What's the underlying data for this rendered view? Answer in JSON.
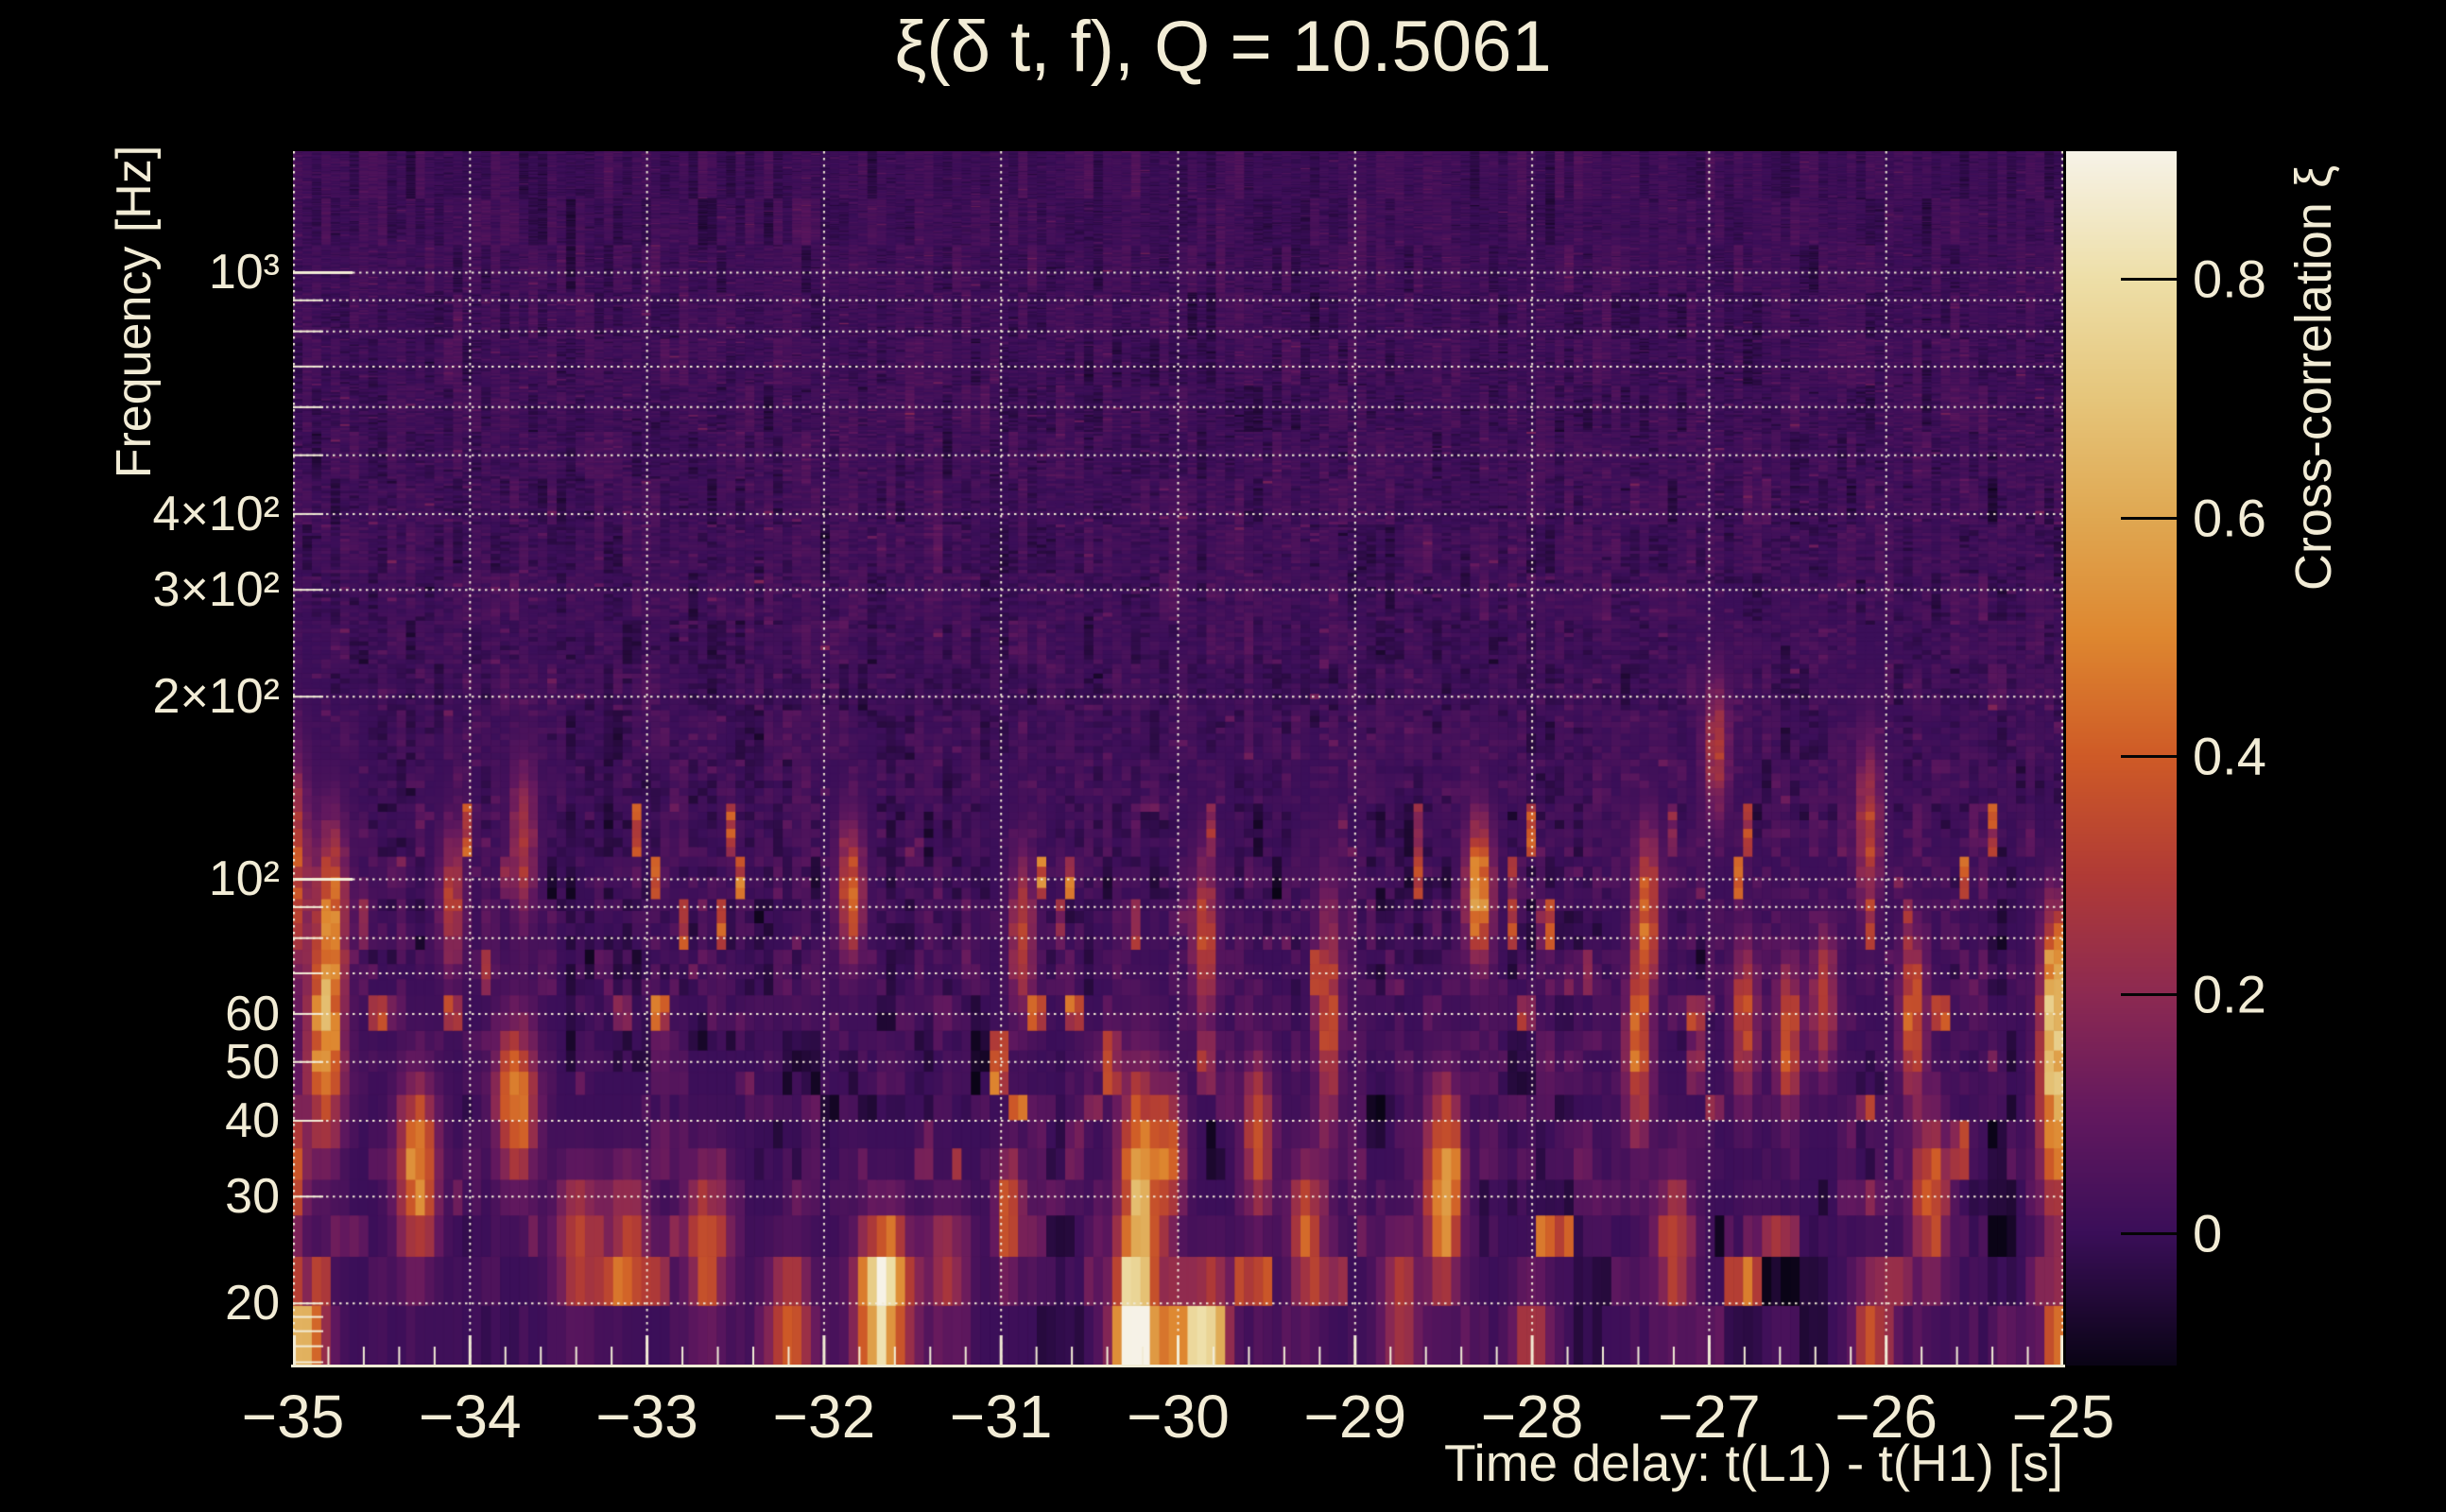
{
  "page": {
    "background": "#000000",
    "text_color": "#f2ecd6",
    "grid_color": "#f1ead6"
  },
  "title": {
    "text": "ξ(δ t, f), Q = 10.5061"
  },
  "chart_data": {
    "type": "heatmap",
    "title": "ξ(δ t, f), Q = 10.5061",
    "xlabel": "Time delay: t(L1) - t(H1) [s]",
    "ylabel": "Frequency [Hz]",
    "x_range": [
      -35,
      -25
    ],
    "x_major_ticks": [
      -35,
      -34,
      -33,
      -32,
      -31,
      -30,
      -29,
      -28,
      -27,
      -26,
      -25
    ],
    "x_tick_labels": [
      "−35",
      "−34",
      "−33",
      "−32",
      "−31",
      "−30",
      "−29",
      "−28",
      "−27",
      "−26",
      "−25"
    ],
    "x_minor_tick_step": 0.2,
    "y_scale": "log",
    "y_range": [
      15.8,
      1585
    ],
    "y_labeled_ticks": [
      {
        "value": 1000,
        "label": "10³"
      },
      {
        "value": 400,
        "label": "4×10²"
      },
      {
        "value": 300,
        "label": "3×10²"
      },
      {
        "value": 200,
        "label": "2×10²"
      },
      {
        "value": 100,
        "label": "10²"
      },
      {
        "value": 60,
        "label": "60"
      },
      {
        "value": 50,
        "label": "50"
      },
      {
        "value": 40,
        "label": "40"
      },
      {
        "value": 30,
        "label": "30"
      },
      {
        "value": 20,
        "label": "20"
      }
    ],
    "y_major_ticks": [
      100,
      1000
    ],
    "y_minor_ticks": [
      16,
      17,
      18,
      19,
      20,
      30,
      40,
      50,
      60,
      70,
      80,
      90,
      200,
      300,
      400,
      500,
      600,
      700,
      800,
      900
    ],
    "grid": true,
    "grid_frequencies": [
      20,
      30,
      40,
      50,
      60,
      70,
      80,
      90,
      100,
      200,
      300,
      400,
      500,
      600,
      700,
      800,
      900,
      1000
    ],
    "colorbar": {
      "label": "Cross-correlation ξ",
      "min": -0.111,
      "max": 0.907,
      "ticks": [
        0,
        0.2,
        0.4,
        0.6,
        0.8
      ],
      "tick_labels": [
        "0",
        "0.2",
        "0.4",
        "0.6",
        "0.8"
      ]
    },
    "palette": [
      {
        "v": -0.111,
        "color": "#0a0416"
      },
      {
        "v": 0.0,
        "color": "#3b0f59"
      },
      {
        "v": 0.1,
        "color": "#63195f"
      },
      {
        "v": 0.2,
        "color": "#8d2a52"
      },
      {
        "v": 0.3,
        "color": "#b13b36"
      },
      {
        "v": 0.4,
        "color": "#cf5b27"
      },
      {
        "v": 0.5,
        "color": "#de8730"
      },
      {
        "v": 0.6,
        "color": "#e0a852"
      },
      {
        "v": 0.7,
        "color": "#e6c67b"
      },
      {
        "v": 0.8,
        "color": "#eedfa8"
      },
      {
        "v": 0.907,
        "color": "#f7f3e8"
      }
    ],
    "hotspots": [
      [
        -34.95,
        17,
        0.6,
        0.1,
        0.07
      ],
      [
        -34.82,
        54,
        0.56,
        0.07,
        0.12
      ],
      [
        -34.78,
        90,
        0.4,
        0.06,
        0.1
      ],
      [
        -35.0,
        105,
        0.38,
        0.06,
        0.12
      ],
      [
        -35.0,
        33,
        0.4,
        0.05,
        0.08
      ],
      [
        -34.3,
        33,
        0.55,
        0.08,
        0.1
      ],
      [
        -34.1,
        92,
        0.32,
        0.05,
        0.08
      ],
      [
        -33.74,
        43,
        0.5,
        0.08,
        0.09
      ],
      [
        -33.7,
        115,
        0.3,
        0.05,
        0.09
      ],
      [
        -33.38,
        25,
        0.35,
        0.1,
        0.08
      ],
      [
        -33.1,
        27,
        0.3,
        0.08,
        0.07
      ],
      [
        -32.66,
        25,
        0.4,
        0.09,
        0.09
      ],
      [
        -32.2,
        18,
        0.46,
        0.09,
        0.08
      ],
      [
        -31.85,
        95,
        0.42,
        0.05,
        0.08
      ],
      [
        -31.66,
        20.5,
        0.95,
        0.1,
        0.08
      ],
      [
        -31.3,
        23,
        0.3,
        0.08,
        0.07
      ],
      [
        -30.95,
        28,
        0.46,
        0.05,
        0.07
      ],
      [
        -30.88,
        80,
        0.35,
        0.05,
        0.09
      ],
      [
        -30.25,
        18.5,
        0.8,
        0.09,
        0.07
      ],
      [
        -30.22,
        30,
        0.62,
        0.08,
        0.14
      ],
      [
        -30.05,
        35,
        0.36,
        0.06,
        0.08
      ],
      [
        -29.95,
        17,
        0.62,
        0.1,
        0.07
      ],
      [
        -29.85,
        80,
        0.38,
        0.05,
        0.09
      ],
      [
        -29.8,
        18,
        0.5,
        0.07,
        0.07
      ],
      [
        -29.55,
        38,
        0.4,
        0.06,
        0.09
      ],
      [
        -29.27,
        26,
        0.4,
        0.07,
        0.09
      ],
      [
        -29.15,
        60,
        0.36,
        0.05,
        0.14
      ],
      [
        -28.75,
        20,
        0.32,
        0.08,
        0.08
      ],
      [
        -28.5,
        31,
        0.63,
        0.07,
        0.11
      ],
      [
        -28.3,
        95,
        0.6,
        0.05,
        0.08
      ],
      [
        -28.0,
        17,
        0.32,
        0.08,
        0.07
      ],
      [
        -27.4,
        52,
        0.45,
        0.05,
        0.1
      ],
      [
        -27.35,
        90,
        0.42,
        0.05,
        0.09
      ],
      [
        -27.2,
        25,
        0.34,
        0.08,
        0.09
      ],
      [
        -26.96,
        165,
        0.3,
        0.05,
        0.08
      ],
      [
        -26.8,
        58,
        0.38,
        0.05,
        0.09
      ],
      [
        -26.55,
        55,
        0.4,
        0.05,
        0.09
      ],
      [
        -26.35,
        63,
        0.36,
        0.05,
        0.08
      ],
      [
        -26.1,
        120,
        0.32,
        0.05,
        0.1
      ],
      [
        -26.07,
        18,
        0.36,
        0.08,
        0.07
      ],
      [
        -25.85,
        60,
        0.45,
        0.05,
        0.09
      ],
      [
        -25.75,
        30,
        0.45,
        0.07,
        0.09
      ],
      [
        -25.05,
        45,
        0.62,
        0.06,
        0.14
      ],
      [
        -25.02,
        17,
        0.55,
        0.06,
        0.08
      ],
      [
        -25.05,
        70,
        0.45,
        0.05,
        0.08
      ]
    ],
    "noise": {
      "seed": 1337,
      "columns": 188,
      "row_df_hz": 4.06,
      "bands": 26,
      "base": 0.012,
      "amp_min": 0.018,
      "amp_span": 0.058,
      "spike_prob": 0.05,
      "spike_max_f": 130
    }
  }
}
